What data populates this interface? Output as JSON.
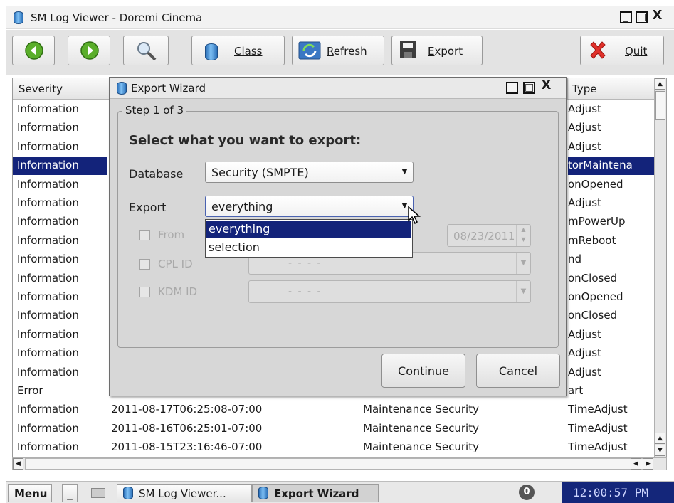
{
  "window": {
    "title": "SM Log Viewer - Doremi Cinema",
    "minimize_glyph": "_",
    "maximize_glyph": "□",
    "close_glyph": "X"
  },
  "toolbar": {
    "class_label": "Class",
    "refresh_label": "Refresh",
    "export_label": "Export",
    "quit_label": "Quit"
  },
  "table": {
    "columns": [
      "Severity",
      "Type"
    ],
    "rows": [
      {
        "severity": "Information",
        "date": "",
        "class": "",
        "type": "Adjust"
      },
      {
        "severity": "Information",
        "date": "",
        "class": "",
        "type": "Adjust"
      },
      {
        "severity": "Information",
        "date": "",
        "class": "",
        "type": "Adjust"
      },
      {
        "severity": "Information",
        "date": "",
        "class": "",
        "type": "torMaintena"
      },
      {
        "severity": "Information",
        "date": "",
        "class": "",
        "type": "onOpened"
      },
      {
        "severity": "Information",
        "date": "",
        "class": "",
        "type": "Adjust"
      },
      {
        "severity": "Information",
        "date": "",
        "class": "",
        "type": "mPowerUp"
      },
      {
        "severity": "Information",
        "date": "",
        "class": "",
        "type": "mReboot"
      },
      {
        "severity": "Information",
        "date": "",
        "class": "",
        "type": "nd"
      },
      {
        "severity": "Information",
        "date": "",
        "class": "",
        "type": "onClosed"
      },
      {
        "severity": "Information",
        "date": "",
        "class": "",
        "type": "onOpened"
      },
      {
        "severity": "Information",
        "date": "",
        "class": "",
        "type": "onClosed"
      },
      {
        "severity": "Information",
        "date": "",
        "class": "",
        "type": "Adjust"
      },
      {
        "severity": "Information",
        "date": "",
        "class": "",
        "type": "Adjust"
      },
      {
        "severity": "Information",
        "date": "",
        "class": "",
        "type": "Adjust"
      },
      {
        "severity": "Error",
        "date": "",
        "class": "",
        "type": "art"
      },
      {
        "severity": "Information",
        "date": "2011-08-17T06:25:08-07:00",
        "class": "Maintenance Security",
        "type": "TimeAdjust"
      },
      {
        "severity": "Information",
        "date": "2011-08-16T06:25:01-07:00",
        "class": "Maintenance Security",
        "type": "TimeAdjust"
      },
      {
        "severity": "Information",
        "date": "2011-08-15T23:16:46-07:00",
        "class": "Maintenance Security",
        "type": "TimeAdjust"
      }
    ]
  },
  "dialog": {
    "title": "Export Wizard",
    "step": "Step 1 of 3",
    "heading": "Select what you want to export:",
    "database_label": "Database",
    "database_value": "Security (SMPTE)",
    "export_label": "Export",
    "export_value": "everything",
    "export_options": [
      "everything",
      "selection"
    ],
    "from_label": "From",
    "date_value": "08/23/2011",
    "cpl_label": "CPL ID",
    "kdm_label": "KDM ID",
    "id_placeholder": "- - - -",
    "continue_label": "Continue",
    "cancel_label": "Cancel"
  },
  "taskbar": {
    "menu_label": "Menu",
    "task1": "SM Log Viewer...",
    "task2": "Export Wizard",
    "notification_count": "0",
    "clock": "12:00:57 PM"
  }
}
